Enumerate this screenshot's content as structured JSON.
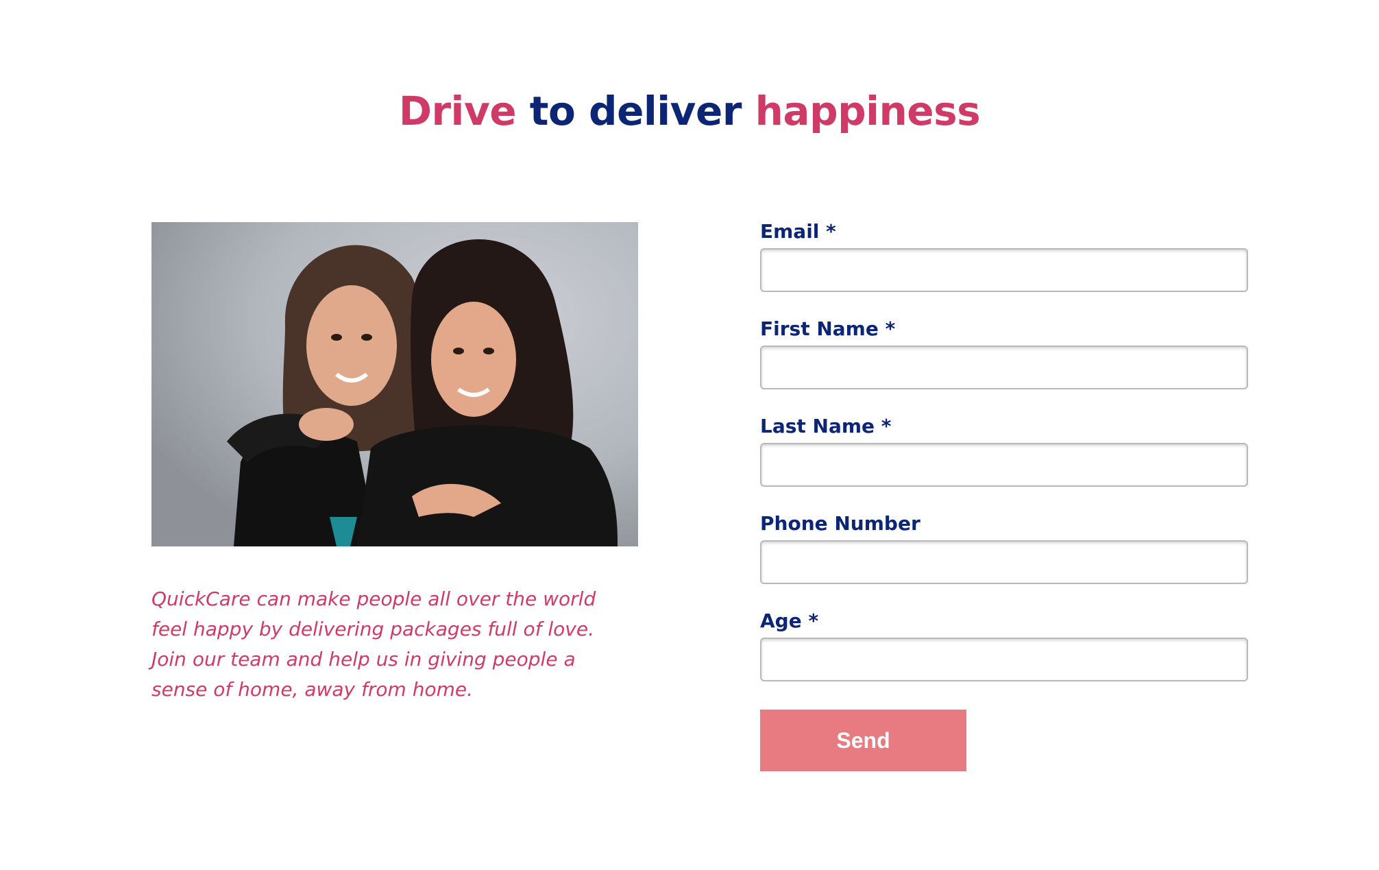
{
  "headline": {
    "part1": "Drive",
    "part2": "to deliver",
    "part3": "happiness",
    "accent_color": "#d03a66",
    "dark_color": "#0c2574"
  },
  "photo": {
    "alt": "Two smiling women embracing"
  },
  "tagline": "QuickCare can make people all over the world feel happy by delivering packages full of love. Join our team and help us in giving people a sense of home, away from home.",
  "form": {
    "fields": [
      {
        "label": "Email *",
        "value": "",
        "placeholder": ""
      },
      {
        "label": "First Name *",
        "value": "",
        "placeholder": ""
      },
      {
        "label": "Last Name *",
        "value": "",
        "placeholder": ""
      },
      {
        "label": "Phone Number",
        "value": "",
        "placeholder": ""
      },
      {
        "label": "Age *",
        "value": "",
        "placeholder": ""
      }
    ],
    "submit_label": "Send",
    "submit_color": "#e87b82"
  }
}
